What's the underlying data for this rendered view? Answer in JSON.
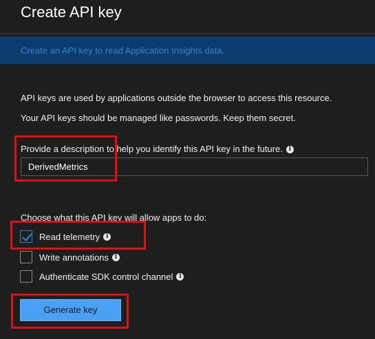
{
  "header": {
    "title": "Create API key"
  },
  "banner": {
    "text": "Create an API key to read Application Insights data."
  },
  "intro": {
    "line1": "API keys are used by applications outside the browser to access this resource.",
    "line2": "Your API keys should be managed like passwords. Keep them secret."
  },
  "description": {
    "label": "Provide a description to help you identify this API key in the future.",
    "value": "DerivedMetrics"
  },
  "permissions": {
    "label": "Choose what this API key will allow apps to do:",
    "options": [
      {
        "label": "Read telemetry",
        "checked": true
      },
      {
        "label": "Write annotations",
        "checked": false
      },
      {
        "label": "Authenticate SDK control channel",
        "checked": false
      }
    ]
  },
  "actions": {
    "generate_label": "Generate key"
  },
  "colors": {
    "background": "#1e1e1e",
    "banner": "#0a3c6e",
    "accent": "#2b88d8",
    "button": "#4aa0f5",
    "highlight": "#e01010"
  },
  "icons": {
    "info": "info-icon",
    "check": "checkmark-icon"
  }
}
